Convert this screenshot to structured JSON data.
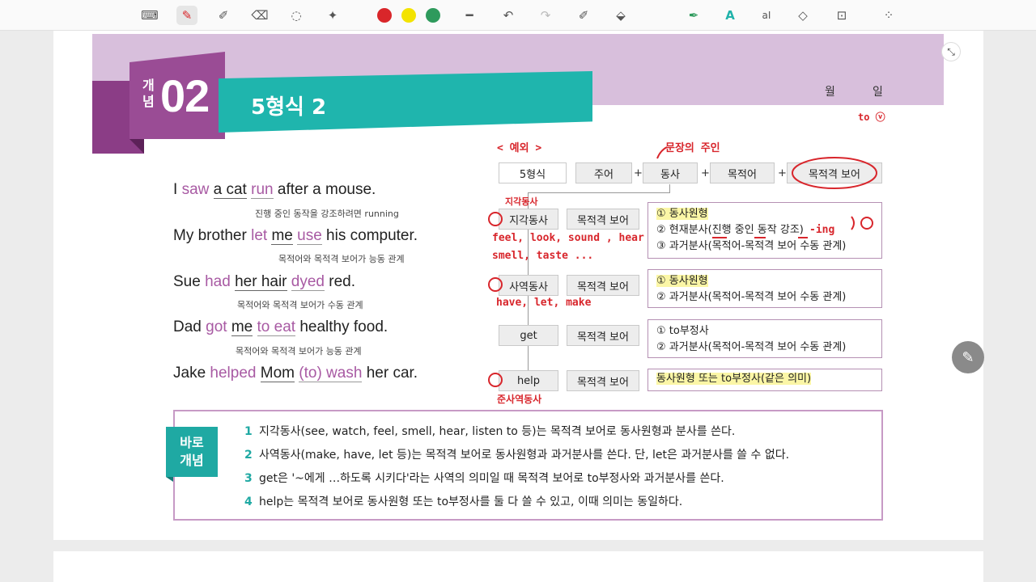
{
  "toolbar": {
    "tools": [
      {
        "name": "keyboard-icon",
        "glyph": "⌨"
      },
      {
        "name": "pen-icon",
        "glyph": "✎"
      },
      {
        "name": "highlighter-icon",
        "glyph": "🖍"
      },
      {
        "name": "eraser-icon",
        "glyph": "⌫"
      },
      {
        "name": "lasso-icon",
        "glyph": "◌"
      },
      {
        "name": "sparkle-icon",
        "glyph": "✦"
      },
      {
        "name": "line-icon",
        "glyph": "━"
      },
      {
        "name": "undo-icon",
        "glyph": "↶"
      },
      {
        "name": "redo-icon",
        "glyph": "↷"
      },
      {
        "name": "shape-pen-icon",
        "glyph": "✐"
      },
      {
        "name": "fill-icon",
        "glyph": "⬙"
      },
      {
        "name": "marker-icon",
        "glyph": "✒"
      },
      {
        "name": "text-style-icon",
        "glyph": "A"
      },
      {
        "name": "text-box-icon",
        "glyph": "a͟I"
      },
      {
        "name": "shapes-icon",
        "glyph": "◇"
      },
      {
        "name": "lock-icon",
        "glyph": "🔒"
      },
      {
        "name": "more-apps-icon",
        "glyph": "⁘"
      }
    ],
    "colors": [
      "#d9262a",
      "#f3e300",
      "#2e9a5c"
    ]
  },
  "header": {
    "gae": "개념",
    "number": "02",
    "title": "5형식 2",
    "month_label": "월",
    "day_label": "일"
  },
  "sentences": [
    {
      "parts": [
        "I ",
        "saw",
        " ",
        "a cat",
        " ",
        "run",
        " after a mouse."
      ],
      "note": "진행 중인 동작을 강조하려면 running"
    },
    {
      "parts": [
        "My brother ",
        "let",
        " ",
        "me",
        " ",
        "use",
        " his computer."
      ],
      "note": "목적어와 목적격 보어가 능동 관계"
    },
    {
      "parts": [
        "Sue ",
        "had",
        " ",
        "her hair",
        " ",
        "dyed",
        " red."
      ],
      "note": "목적어와 목적격 보어가 수동 관계"
    },
    {
      "parts": [
        "Dad ",
        "got",
        " ",
        "me",
        " ",
        "to eat",
        " healthy food."
      ],
      "note": "목적어와 목적격 보어가 능동 관계"
    },
    {
      "parts": [
        "Jake ",
        "helped",
        " ",
        "Mom",
        " ",
        "(to) wash",
        " her car."
      ],
      "note": ""
    }
  ],
  "diagram": {
    "top_row": [
      "5형식",
      "주어",
      "동사",
      "목적어",
      "목적격 보어"
    ],
    "rows": [
      {
        "verb": "지각동사",
        "comp": "목적격 보어",
        "items": [
          "① 동사원형",
          "② 현재분사(진행 중인 동작 강조)",
          "③ 과거분사(목적어-목적격 보어 수동 관계)"
        ]
      },
      {
        "verb": "사역동사",
        "comp": "목적격 보어",
        "items": [
          "① 동사원형",
          "② 과거분사(목적어-목적격 보어 수동 관계)"
        ]
      },
      {
        "verb": "get",
        "comp": "목적격 보어",
        "items": [
          "① to부정사",
          "② 과거분사(목적어-목적격 보어 수동 관계)"
        ]
      },
      {
        "verb": "help",
        "comp": "목적격 보어",
        "items": [
          "동사원형 또는 to부정사(같은 의미)"
        ]
      }
    ]
  },
  "handwriting": {
    "example": "< 예외 >",
    "sentence_owner": "문장의 주인",
    "to_v": "to ⓥ",
    "perception_label": "지각동사",
    "perception_examples_1": "feel, look, sound , hear",
    "perception_examples_2": "smell, taste ...",
    "ing": "-ing",
    "causative_examples": "have, let, make",
    "semi_causative": "준사역동사"
  },
  "concept": {
    "tag_line1": "바로",
    "tag_line2": "개념",
    "items": [
      {
        "n": "1",
        "text": "지각동사(see, watch, feel, smell, hear, listen to 등)는 목적격 보어로 동사원형과 분사를 쓴다."
      },
      {
        "n": "2",
        "text": "사역동사(make, have, let 등)는 목적격 보어로 동사원형과 과거분사를 쓴다. 단, let은 과거분사를 쓸 수 없다."
      },
      {
        "n": "3",
        "text": "get은 '~에게 …하도록 시키다'라는 사역의 의미일 때 목적격 보어로 to부정사와 과거분사를 쓴다."
      },
      {
        "n": "4",
        "text": "help는 목적격 보어로 동사원형 또는 to부정사를 둘 다 쓸 수 있고, 이때 의미는 동일하다."
      }
    ]
  }
}
